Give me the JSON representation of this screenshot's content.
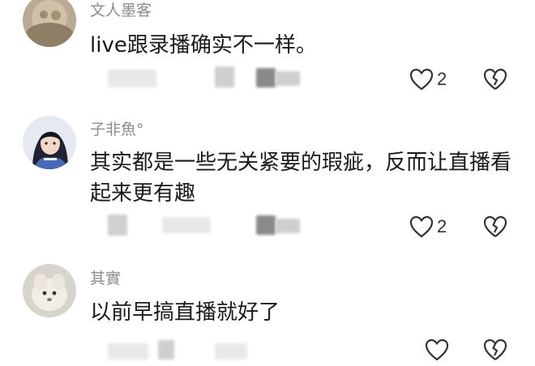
{
  "comments": [
    {
      "username": "文人墨客",
      "text": "live跟录播确实不一样。",
      "like_count": "2"
    },
    {
      "username": "子非魚°",
      "text": "其实都是一些无关紧要的瑕疵，反而让直播看起来更有趣",
      "like_count": "2"
    },
    {
      "username": "其實",
      "text": "以前早搞直播就好了",
      "like_count": ""
    }
  ],
  "icons": {
    "like": "heart-outline-icon",
    "dislike": "broken-heart-icon"
  },
  "colors": {
    "username": "#8c8c8c",
    "text": "#1a1a1a",
    "icon": "#333333"
  }
}
